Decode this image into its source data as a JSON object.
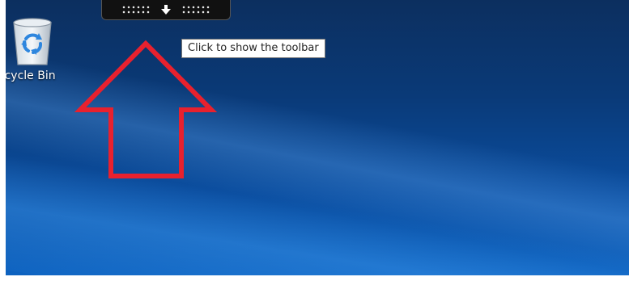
{
  "desktop": {
    "icons": [
      {
        "label": "ecycle Bin",
        "icon": "recycle-bin-icon"
      }
    ]
  },
  "remote_toolbar": {
    "icon": "arrow-down-icon",
    "tooltip": "Click to show the toolbar"
  },
  "annotation": {
    "icon": "arrow-up-outline-icon",
    "color": "#e8212e"
  },
  "colors": {
    "desktop_dark": "#0c2f5f",
    "desktop_light": "#0d62c0"
  }
}
